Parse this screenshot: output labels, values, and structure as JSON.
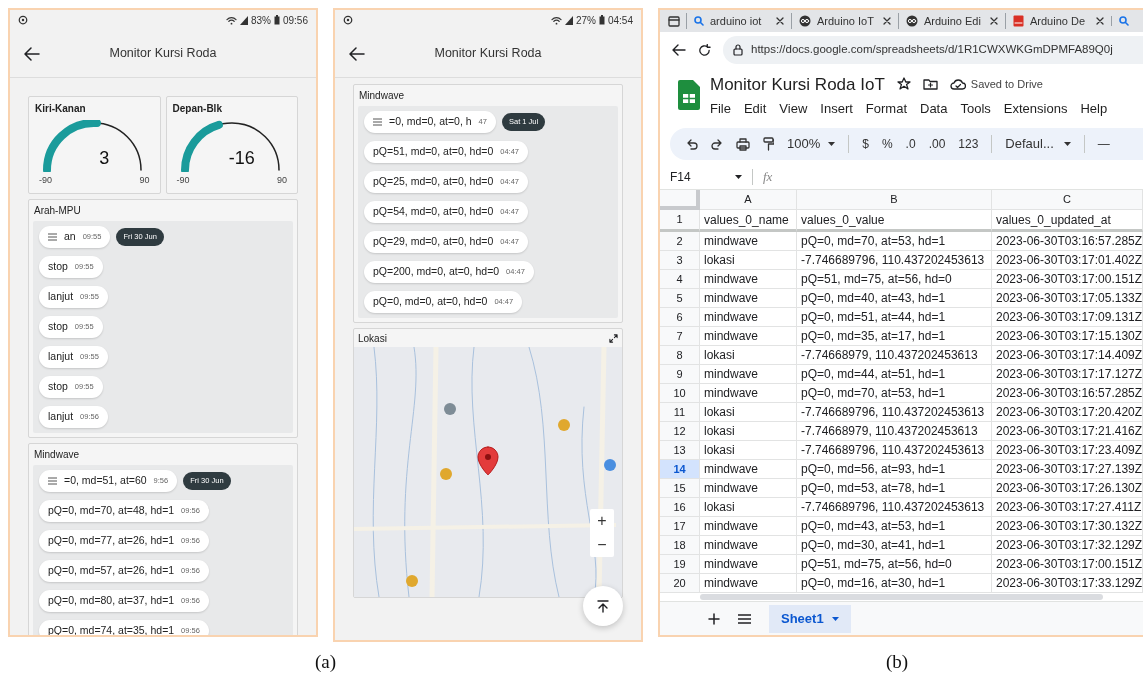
{
  "phones": [
    {
      "status_bar": {
        "battery": "83%",
        "time": "09:56"
      },
      "app_bar": {
        "title": "Monitor Kursi Roda"
      },
      "gauges": [
        {
          "title": "Kiri-Kanan",
          "value": "3",
          "min": "-90",
          "max": "90",
          "level": 0.52
        },
        {
          "title": "Depan-Blk",
          "value": "-16",
          "min": "-90",
          "max": "90",
          "level": 0.41
        }
      ],
      "cards": [
        {
          "kind": "feed",
          "title": "Arah-MPU",
          "date_chip": "Fri 30 Jun",
          "messages": [
            {
              "text": "an",
              "time": "09:55"
            },
            {
              "text": "stop",
              "time": "09:55"
            },
            {
              "text": "lanjut",
              "time": "09:55"
            },
            {
              "text": "stop",
              "time": "09:55"
            },
            {
              "text": "lanjut",
              "time": "09:55"
            },
            {
              "text": "stop",
              "time": "09:55"
            },
            {
              "text": "lanjut",
              "time": "09:56"
            }
          ]
        },
        {
          "kind": "feed",
          "title": "Mindwave",
          "date_chip": "Fri 30 Jun",
          "messages": [
            {
              "text": "=0, md=51, at=60",
              "time": "9:56"
            },
            {
              "text": "pQ=0, md=70, at=48, hd=1",
              "time": "09:56"
            },
            {
              "text": "pQ=0, md=77, at=26, hd=1",
              "time": "09:56"
            },
            {
              "text": "pQ=0, md=57, at=26, hd=1",
              "time": "09:56"
            },
            {
              "text": "pQ=0, md=80, at=37, hd=1",
              "time": "09:56"
            },
            {
              "text": "pQ=0, md=74, at=35, hd=1",
              "time": "09:56"
            }
          ]
        }
      ]
    },
    {
      "status_bar": {
        "battery": "27%",
        "time": "04:54"
      },
      "app_bar": {
        "title": "Monitor Kursi Roda"
      },
      "cards": [
        {
          "kind": "feed",
          "title": "Mindwave",
          "date_chip": "Sat 1 Jul",
          "messages": [
            {
              "text": "=0, md=0, at=0, h",
              "time": "47"
            },
            {
              "text": "pQ=51, md=0, at=0, hd=0",
              "time": "04:47"
            },
            {
              "text": "pQ=25, md=0, at=0, hd=0",
              "time": "04:47"
            },
            {
              "text": "pQ=54, md=0, at=0, hd=0",
              "time": "04:47"
            },
            {
              "text": "pQ=29, md=0, at=0, hd=0",
              "time": "04:47"
            },
            {
              "text": "pQ=200, md=0, at=0, hd=0",
              "time": "04:47"
            },
            {
              "text": "pQ=0, md=0, at=0, hd=0",
              "time": "04:47"
            }
          ]
        },
        {
          "kind": "map",
          "title": "Lokasi",
          "zoom_in": "+",
          "zoom_out": "−"
        }
      ]
    }
  ],
  "browser": {
    "tabs": [
      {
        "label": "arduino iot",
        "kind": "search"
      },
      {
        "label": "Arduino IoT",
        "kind": "arduino"
      },
      {
        "label": "Arduino Edi",
        "kind": "arduino"
      },
      {
        "label": "Arduino De",
        "kind": "pdf"
      },
      {
        "kind": "search"
      }
    ],
    "url": "https://docs.google.com/spreadsheets/d/1R1CWXWKGmDPMFA89Q0j",
    "doc_title": "Monitor Kursi Roda IoT",
    "save_status": "Saved to Drive",
    "menu": [
      "File",
      "Edit",
      "View",
      "Insert",
      "Format",
      "Data",
      "Tools",
      "Extensions",
      "Help"
    ],
    "toolbar": {
      "zoom": "100%",
      "format_buttons": [
        "$",
        "%",
        ".0",
        ".00",
        "123"
      ],
      "font": "Defaul...",
      "font_size_minus": "—"
    },
    "name_box": "F14",
    "formula_label": "fx",
    "columns": [
      "A",
      "B",
      "C"
    ],
    "rows": [
      {
        "number": "1",
        "selected": false,
        "cells": [
          "values_0_name",
          "values_0_value",
          "values_0_updated_at"
        ]
      },
      {
        "number": "2",
        "selected": false,
        "cells": [
          "mindwave",
          "pQ=0, md=70, at=53, hd=1",
          "2023-06-30T03:16:57.285Z"
        ]
      },
      {
        "number": "3",
        "selected": false,
        "cells": [
          "lokasi",
          "-7.746689796, 110.437202453613",
          "2023-06-30T03:17:01.402Z"
        ]
      },
      {
        "number": "4",
        "selected": false,
        "cells": [
          "mindwave",
          "pQ=51, md=75, at=56, hd=0",
          "2023-06-30T03:17:00.151Z"
        ]
      },
      {
        "number": "5",
        "selected": false,
        "cells": [
          "mindwave",
          "pQ=0, md=40, at=43, hd=1",
          "2023-06-30T03:17:05.133Z"
        ]
      },
      {
        "number": "6",
        "selected": false,
        "cells": [
          "mindwave",
          "pQ=0, md=51, at=44, hd=1",
          "2023-06-30T03:17:09.131Z"
        ]
      },
      {
        "number": "7",
        "selected": false,
        "cells": [
          "mindwave",
          "pQ=0, md=35, at=17, hd=1",
          "2023-06-30T03:17:15.130Z"
        ]
      },
      {
        "number": "8",
        "selected": false,
        "cells": [
          "lokasi",
          "-7.74668979, 110.437202453613",
          "2023-06-30T03:17:14.409Z"
        ]
      },
      {
        "number": "9",
        "selected": false,
        "cells": [
          "mindwave",
          "pQ=0, md=44, at=51, hd=1",
          "2023-06-30T03:17:17.127Z"
        ]
      },
      {
        "number": "10",
        "selected": false,
        "cells": [
          "mindwave",
          "pQ=0, md=70, at=53, hd=1",
          "2023-06-30T03:16:57.285Z"
        ]
      },
      {
        "number": "11",
        "selected": false,
        "cells": [
          "lokasi",
          "-7.746689796, 110.437202453613",
          "2023-06-30T03:17:20.420Z"
        ]
      },
      {
        "number": "12",
        "selected": false,
        "cells": [
          "lokasi",
          "-7.74668979, 110.437202453613",
          "2023-06-30T03:17:21.416Z"
        ]
      },
      {
        "number": "13",
        "selected": false,
        "cells": [
          "lokasi",
          "-7.746689796, 110.437202453613",
          "2023-06-30T03:17:23.409Z"
        ]
      },
      {
        "number": "14",
        "selected": true,
        "cells": [
          "mindwave",
          "pQ=0, md=56, at=93, hd=1",
          "2023-06-30T03:17:27.139Z"
        ]
      },
      {
        "number": "15",
        "selected": false,
        "cells": [
          "mindwave",
          "pQ=0, md=53, at=78, hd=1",
          "2023-06-30T03:17:26.130Z"
        ]
      },
      {
        "number": "16",
        "selected": false,
        "cells": [
          "lokasi",
          "-7.746689796, 110.437202453613",
          "2023-06-30T03:17:27.411Z"
        ]
      },
      {
        "number": "17",
        "selected": false,
        "cells": [
          "mindwave",
          "pQ=0, md=43, at=53, hd=1",
          "2023-06-30T03:17:30.132Z"
        ]
      },
      {
        "number": "18",
        "selected": false,
        "cells": [
          "mindwave",
          "pQ=0, md=30, at=41, hd=1",
          "2023-06-30T03:17:32.129Z"
        ]
      },
      {
        "number": "19",
        "selected": false,
        "cells": [
          "mindwave",
          "pQ=51, md=75, at=56, hd=0",
          "2023-06-30T03:17:00.151Z"
        ]
      },
      {
        "number": "20",
        "selected": false,
        "cells": [
          "mindwave",
          "pQ=0, md=16, at=30, hd=1",
          "2023-06-30T03:17:33.129Z"
        ]
      }
    ],
    "sheet_tabs": [
      {
        "label": "Sheet1",
        "selected": true
      }
    ]
  },
  "captions": [
    "(a)",
    "(b)"
  ]
}
